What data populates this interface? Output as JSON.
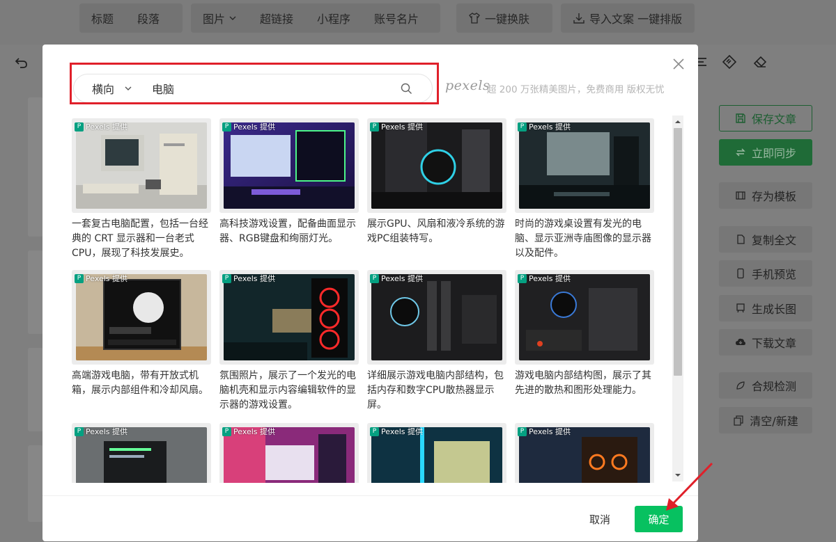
{
  "toolbar": {
    "title_label": "标题",
    "paragraph_label": "段落",
    "image_label": "图片",
    "hyperlink_label": "超链接",
    "miniprogram_label": "小程序",
    "account_card_label": "账号名片",
    "one_click_skin_label": "一键换肤",
    "import_label": "导入文案 一键排版"
  },
  "sidebar": {
    "save_article": "保存文章",
    "sync_now": "立即同步",
    "save_template": "存为模板",
    "copy_all": "复制全文",
    "mobile_preview": "手机预览",
    "generate_long_image": "生成长图",
    "download_article": "下载文章",
    "compliance_check": "合规检测",
    "clear_new": "清空/新建"
  },
  "modal": {
    "orientation": "横向",
    "search_value": "电脑",
    "brand": "pexels",
    "slogan": "超 200 万张精美图片，免费商用 版权无忧",
    "badge_text": "Pexels 提供",
    "cancel_label": "取消",
    "confirm_label": "确定",
    "accent_color": "#07c160",
    "highlight_color": "#e0202a",
    "cards": [
      {
        "desc": "一套复古电脑配置，包括一台经典的 CRT 显示器和一台老式 CPU，展现了科技发展史。"
      },
      {
        "desc": "高科技游戏设置，配备曲面显示器、RGB键盘和绚丽灯光。"
      },
      {
        "desc": "展示GPU、风扇和液冷系统的游戏PC组装特写。"
      },
      {
        "desc": "时尚的游戏桌设置有发光的电脑、显示亚洲寺庙图像的显示器以及配件。"
      },
      {
        "desc": "高端游戏电脑，带有开放式机箱，展示内部组件和冷却风扇。"
      },
      {
        "desc": "氛围照片，展示了一个发光的电脑机壳和显示内容编辑软件的显示器的游戏设置。"
      },
      {
        "desc": "详细展示游戏电脑内部结构，包括内存和数字CPU散热器显示屏。"
      },
      {
        "desc": "游戏电脑内部结构图，展示了其先进的散热和图形处理能力。"
      },
      {
        "desc": ""
      },
      {
        "desc": ""
      },
      {
        "desc": ""
      },
      {
        "desc": ""
      }
    ]
  }
}
